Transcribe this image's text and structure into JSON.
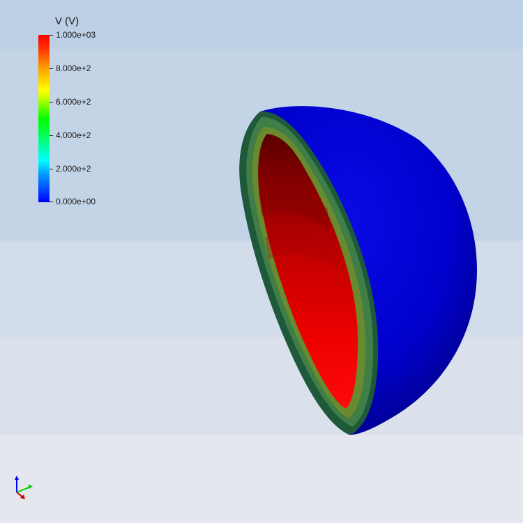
{
  "legend": {
    "title": "V (V)",
    "ticks": [
      {
        "label": "1.000e+03",
        "value": 1000
      },
      {
        "label": "8.000e+2",
        "value": 800
      },
      {
        "label": "6.000e+2",
        "value": 600
      },
      {
        "label": "4.000e+2",
        "value": 400
      },
      {
        "label": "2.000e+2",
        "value": 200
      },
      {
        "label": "0.000e+00",
        "value": 0
      }
    ],
    "range": [
      0,
      1000
    ],
    "colormap": [
      "#0000ff",
      "#00ffff",
      "#00ff00",
      "#ffff00",
      "#ff0000"
    ]
  },
  "scene": {
    "object": "hemispherical-shell-cutaway",
    "outer_surface_color": "#0000dd",
    "inner_surface_color": "#ee0000",
    "rim_color": "#2e8b3a"
  },
  "background": {
    "top_color": "#bccfe4",
    "bottom_color": "#e6e8ee"
  },
  "axes": {
    "x_color": "#ff0000",
    "y_color": "#00cc00",
    "z_color": "#0000ff",
    "icon": "orientation-axes-icon"
  }
}
